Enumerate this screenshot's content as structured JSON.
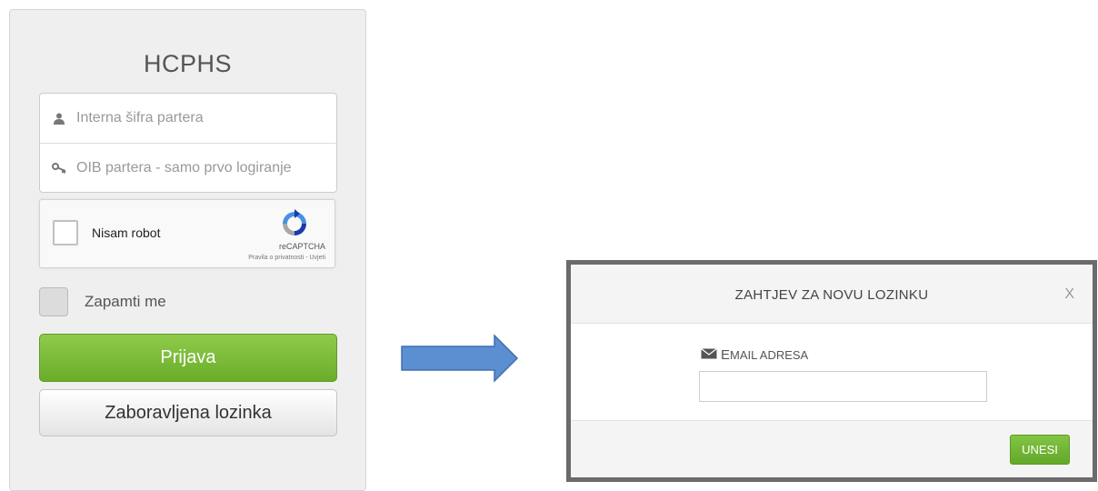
{
  "login": {
    "title": "HCPHS",
    "username_placeholder": "Interna šifra partera",
    "password_placeholder": "OIB partera - samo prvo logiranje",
    "captcha": {
      "label": "Nisam robot",
      "brand": "reCAPTCHA",
      "links": "Pravila o privatnosti - Uvjeti"
    },
    "remember_label": "Zapamti me",
    "login_button": "Prijava",
    "forgot_button": "Zaboravljena lozinka"
  },
  "modal": {
    "title": "ZAHTJEV ZA NOVU LOZINKU",
    "close": "X",
    "email_label_first": "E",
    "email_label_rest": "MAIL ADRESA",
    "email_value": "",
    "submit_button": "UNESI"
  },
  "colors": {
    "accent_green": "#6aad2a",
    "arrow_blue": "#5b8fd1"
  },
  "icons": {
    "user": "user-icon",
    "key": "key-icon",
    "recaptcha": "recaptcha-logo-icon",
    "envelope": "envelope-icon",
    "arrow": "arrow-right-icon"
  }
}
